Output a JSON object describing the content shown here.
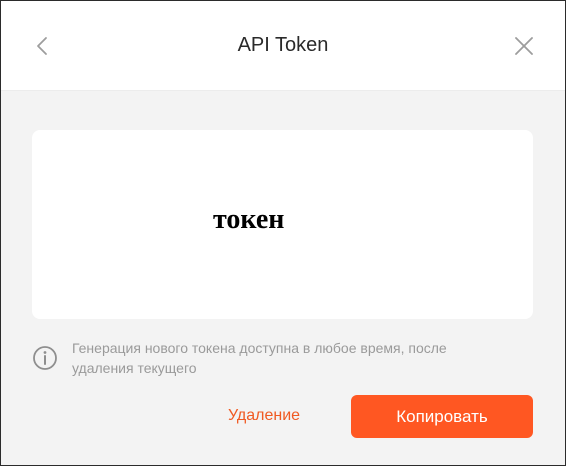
{
  "dialog": {
    "title": "API Token",
    "back_icon": "chevron-left-icon",
    "close_icon": "close-icon"
  },
  "token": {
    "value": "токен"
  },
  "info": {
    "icon": "info-icon",
    "text": "Генерация нового токена доступна в любое время, после удаления текущего"
  },
  "actions": {
    "delete_label": "Удаление",
    "copy_label": "Копировать"
  },
  "colors": {
    "accent": "#ff5722",
    "delete_text": "#f05a22",
    "background": "#f3f3f3",
    "muted_text": "#9a9a9a"
  }
}
